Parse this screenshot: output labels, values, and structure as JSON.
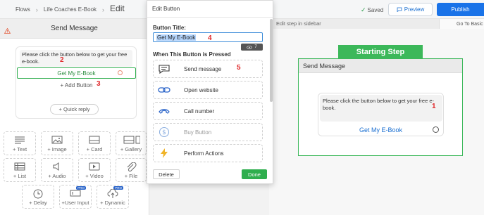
{
  "breadcrumb": {
    "root": "Flows",
    "flow": "Life Coaches E-Book",
    "current": "Edit"
  },
  "header": {
    "saved": "Saved",
    "preview": "Preview",
    "publish": "Publish",
    "accent": "#1a73e8"
  },
  "left_panel": {
    "title": "Send Message",
    "message_text": "Please click the button below to get your free e-book.",
    "button_label": "Get My E-Book",
    "add_button": "+ Add Button",
    "quick_reply": "+ Quick reply",
    "tools": [
      {
        "label": "+ Text",
        "icon": "text-icon"
      },
      {
        "label": "+ Image",
        "icon": "image-icon"
      },
      {
        "label": "+ Card",
        "icon": "card-icon"
      },
      {
        "label": "+ Gallery",
        "icon": "gallery-icon"
      },
      {
        "label": "+ List",
        "icon": "list-icon"
      },
      {
        "label": "+ Audio",
        "icon": "audio-icon"
      },
      {
        "label": "+ Video",
        "icon": "video-icon"
      },
      {
        "label": "+ File",
        "icon": "file-icon"
      },
      {
        "label": "+ Delay",
        "icon": "clock-icon"
      },
      {
        "label": "+User Input",
        "icon": "user-input-icon",
        "badge": "PRO"
      },
      {
        "label": "+ Dynamic",
        "icon": "dynamic-icon",
        "badge": "PRO"
      }
    ]
  },
  "annotations": {
    "n1": "1",
    "n2": "2",
    "n3": "3",
    "n4": "4",
    "n5": "5"
  },
  "modal": {
    "title": "Edit Button",
    "field_label": "Button Title:",
    "field_value": "Get My E-Book",
    "counter": "7",
    "pressed_label": "When This Button is Pressed",
    "actions": [
      {
        "label": "Send message",
        "icon": "chat-icon",
        "enabled": true
      },
      {
        "label": "Open website",
        "icon": "link-icon",
        "enabled": true
      },
      {
        "label": "Call number",
        "icon": "phone-icon",
        "enabled": true
      },
      {
        "label": "Buy Button",
        "icon": "dollar-icon",
        "enabled": false
      },
      {
        "label": "Perform Actions",
        "icon": "bolt-icon",
        "enabled": true
      }
    ],
    "delete": "Delete",
    "done": "Done"
  },
  "canvas": {
    "hint": "Edit step in sidebar",
    "goto": "Go To Basic",
    "start_step": "Starting Step",
    "node_title": "Send Message",
    "node_text": "Please click the button below to get your free e-book.",
    "node_button": "Get My E-Book"
  }
}
